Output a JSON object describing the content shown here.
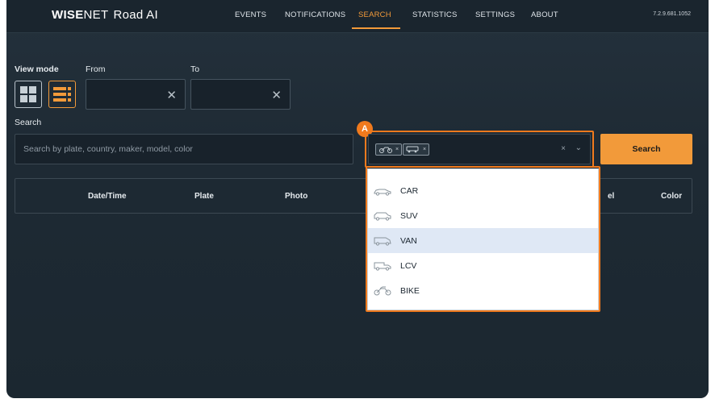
{
  "header": {
    "logo_brand": "WISE",
    "logo_net": "NET",
    "logo_product": "Road AI",
    "nav": [
      {
        "label": "EVENTS"
      },
      {
        "label": "NOTIFICATIONS"
      },
      {
        "label": "SEARCH",
        "active": true
      },
      {
        "label": "STATISTICS"
      },
      {
        "label": "SETTINGS"
      },
      {
        "label": "ABOUT"
      }
    ],
    "version": "7.2.9.681.1052"
  },
  "filters": {
    "view_mode_label": "View mode",
    "from_label": "From",
    "to_label": "To",
    "from_value": "",
    "to_value": "",
    "search_label": "Search",
    "search_placeholder": "Search by plate, country, maker, model, color",
    "type_chips": [
      {
        "icon": "bike-icon",
        "clear": "×"
      },
      {
        "icon": "van-icon",
        "clear": "×"
      }
    ],
    "select_clear": "×",
    "search_button": "Search",
    "callout": "A"
  },
  "table": {
    "columns": [
      "Date/Time",
      "Plate",
      "Photo",
      "el",
      "Color"
    ]
  },
  "dropdown": {
    "options": [
      {
        "label": "CAR",
        "icon": "car-icon"
      },
      {
        "label": "SUV",
        "icon": "suv-icon"
      },
      {
        "label": "VAN",
        "icon": "van-icon",
        "selected": true
      },
      {
        "label": "LCV",
        "icon": "lcv-icon"
      },
      {
        "label": "BIKE",
        "icon": "bike-icon"
      }
    ]
  },
  "colors": {
    "accent": "#f29a3a",
    "highlight": "#f07a1d",
    "background": "#1e2a34",
    "selected_option": "#dfe8f5"
  }
}
